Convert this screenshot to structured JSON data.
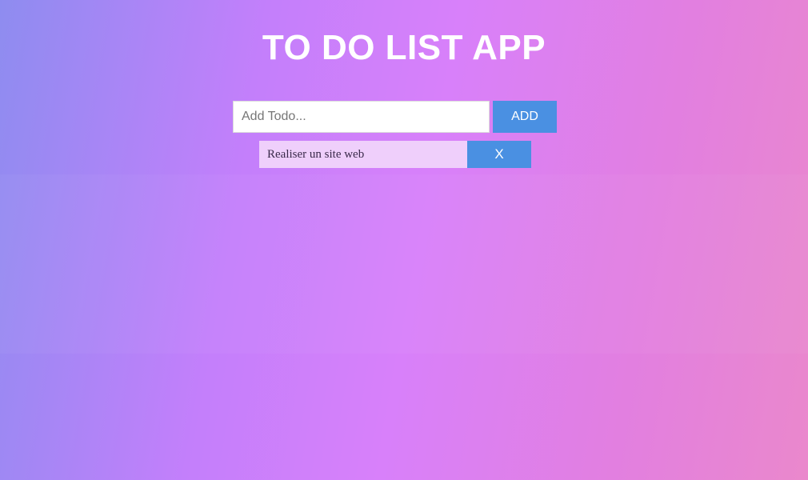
{
  "app": {
    "title": "TO DO LIST APP"
  },
  "form": {
    "input_value": "",
    "input_placeholder": "Add Todo...",
    "add_label": "ADD"
  },
  "todos": [
    {
      "text": "Realiser un site web",
      "delete_label": "X"
    }
  ],
  "colors": {
    "button": "#4a90e2",
    "item_background": "#efcffb",
    "gradient_left": "#8e8cf0",
    "gradient_mid": "#d880fa",
    "gradient_right": "#ea88cc"
  }
}
